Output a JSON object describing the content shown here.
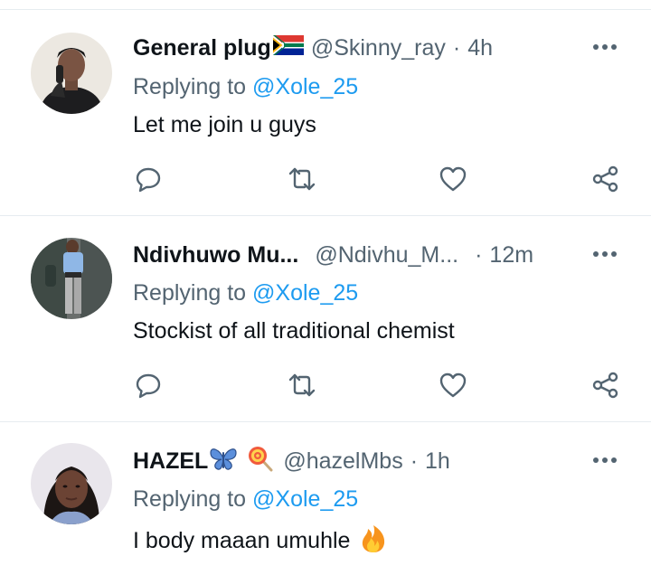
{
  "tweets": [
    {
      "name": "General plug",
      "name_emoji": "south-africa-flag",
      "handle": "@Skinny_ray",
      "separator": "·",
      "time": "4h",
      "replying_prefix": "Replying to",
      "replying_to": "@Xole_25",
      "text": "Let me join u guys"
    },
    {
      "name": "Ndivhuwo Mu...",
      "handle": "@Ndivhu_M...",
      "separator": "·",
      "time": "12m",
      "replying_prefix": "Replying to",
      "replying_to": "@Xole_25",
      "text": "Stockist of all traditional chemist"
    },
    {
      "name": "HAZEL",
      "name_emoji": "butterfly-and-lollipop",
      "handle": "@hazelMbs",
      "separator": "·",
      "time": "1h",
      "replying_prefix": "Replying to",
      "replying_to": "@Xole_25",
      "text": "I body maaan umuhle",
      "text_emoji": "fire"
    }
  ],
  "colors": {
    "primary_text": "#0f1419",
    "secondary_text": "#536471",
    "link": "#1d9bf0",
    "divider": "#e6ecf0"
  }
}
